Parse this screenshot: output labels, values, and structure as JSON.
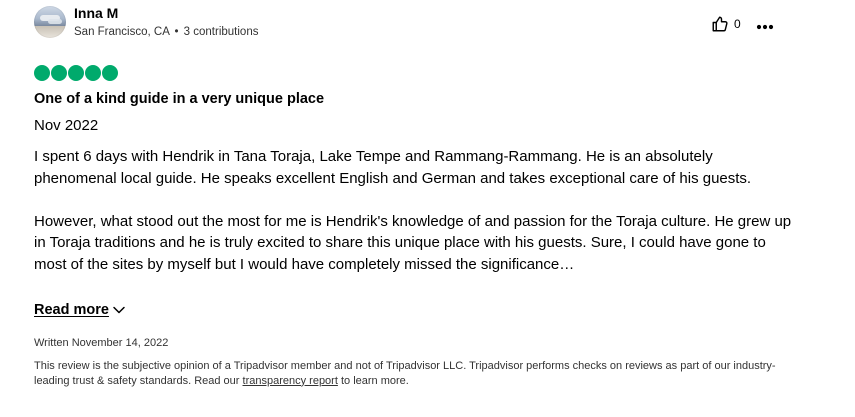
{
  "review": {
    "user": {
      "name": "Inna M",
      "location": "San Francisco, CA",
      "separator": "•",
      "contributions": "3 contributions"
    },
    "helpful": {
      "icon": "thumbs-up-icon",
      "count": "0"
    },
    "more_icon": "more-options-icon",
    "rating": {
      "value": 5,
      "max": 5,
      "color": "#00aa6c"
    },
    "title": "One of a kind guide in a very unique place",
    "visit_date": "Nov 2022",
    "paragraphs": [
      "I spent 6 days with Hendrik in Tana Toraja, Lake Tempe and Rammang-Rammang. He is an absolutely phenomenal local guide. He speaks excellent English and German and takes exceptional care of his guests.",
      "However, what stood out the most for me is Hendrik's knowledge of and passion for the Toraja culture. He grew up in Toraja traditions and he is truly excited to share this unique place with his guests. Sure, I could have gone to most of the sites by myself but I would have completely missed the significance…"
    ],
    "read_more": {
      "label": "Read more",
      "icon": "chevron-down-icon"
    },
    "written_date": "Written November 14, 2022",
    "disclaimer": {
      "before": "This review is the subjective opinion of a Tripadvisor member and not of Tripadvisor LLC. Tripadvisor performs checks on reviews as part of our industry-leading trust & safety standards. Read our ",
      "link": "transparency report",
      "after": " to learn more."
    }
  }
}
